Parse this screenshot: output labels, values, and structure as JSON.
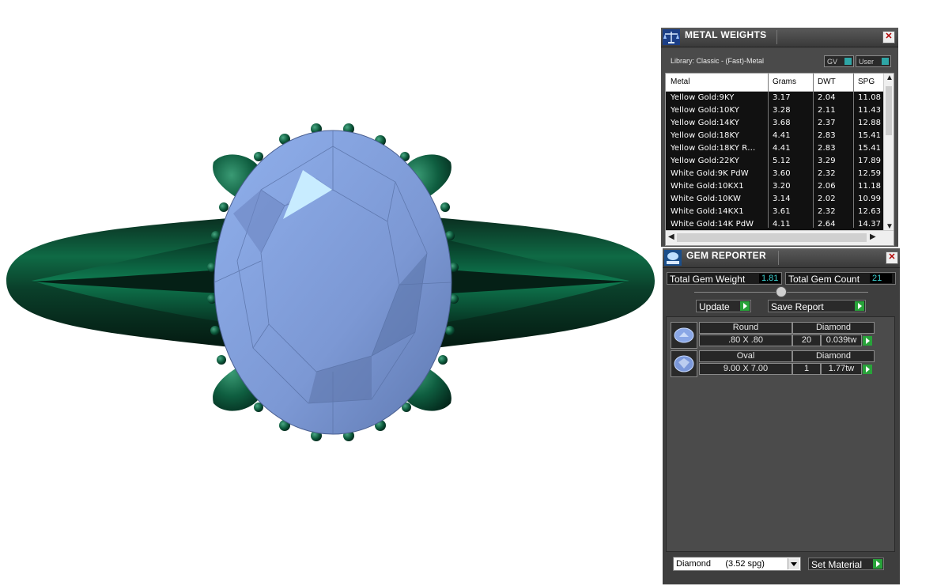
{
  "metal_weights": {
    "title": "METAL WEIGHTS",
    "close": "✕",
    "library_label": "Library: Classic - (Fast)-Metal",
    "toggle_gv": "GV",
    "toggle_user": "User",
    "columns": [
      "Metal",
      "Grams",
      "DWT",
      "SPG"
    ],
    "rows": [
      [
        "Yellow Gold:9KY",
        "3.17",
        "2.04",
        "11.08"
      ],
      [
        "Yellow Gold:10KY",
        "3.28",
        "2.11",
        "11.43"
      ],
      [
        "Yellow Gold:14KY",
        "3.68",
        "2.37",
        "12.88"
      ],
      [
        "Yellow Gold:18KY",
        "4.41",
        "2.83",
        "15.41"
      ],
      [
        "Yellow Gold:18KY R…",
        "4.41",
        "2.83",
        "15.41"
      ],
      [
        "Yellow Gold:22KY",
        "5.12",
        "3.29",
        "17.89"
      ],
      [
        "White Gold:9K PdW",
        "3.60",
        "2.32",
        "12.59"
      ],
      [
        "White Gold:10KX1",
        "3.20",
        "2.06",
        "11.18"
      ],
      [
        "White Gold:10KW",
        "3.14",
        "2.02",
        "10.99"
      ],
      [
        "White Gold:14KX1",
        "3.61",
        "2.32",
        "12.63"
      ],
      [
        "White Gold:14K PdW",
        "4.11",
        "2.64",
        "14.37"
      ]
    ]
  },
  "gem_reporter": {
    "title": "GEM REPORTER",
    "close": "✕",
    "total_weight_label": "Total Gem Weight",
    "total_weight_value": "1.81",
    "total_count_label": "Total Gem Count",
    "total_count_value": "21",
    "update_label": "Update",
    "save_report_label": "Save Report",
    "gems": [
      {
        "shape": "Round",
        "material": "Diamond",
        "size": ".80 X .80",
        "count": "20",
        "weight": "0.039tw"
      },
      {
        "shape": "Oval",
        "material": "Diamond",
        "size": "9.00 X 7.00",
        "count": "1",
        "weight": "1.77tw"
      }
    ],
    "material_select": "Diamond      (3.52 spg)",
    "set_material_label": "Set Material"
  },
  "colors": {
    "metal_green": "#0d5a3c",
    "gem_blue": "#7f9ed8",
    "panel_bg": "#3e3e3e",
    "accent_cyan": "#3dd0d0",
    "go_green": "#28a33a"
  },
  "icons": {
    "metal_weights": "scale-icon",
    "gem_reporter": "gem-report-icon",
    "gem_round": "round-gem-icon",
    "gem_oval": "oval-gem-icon"
  }
}
